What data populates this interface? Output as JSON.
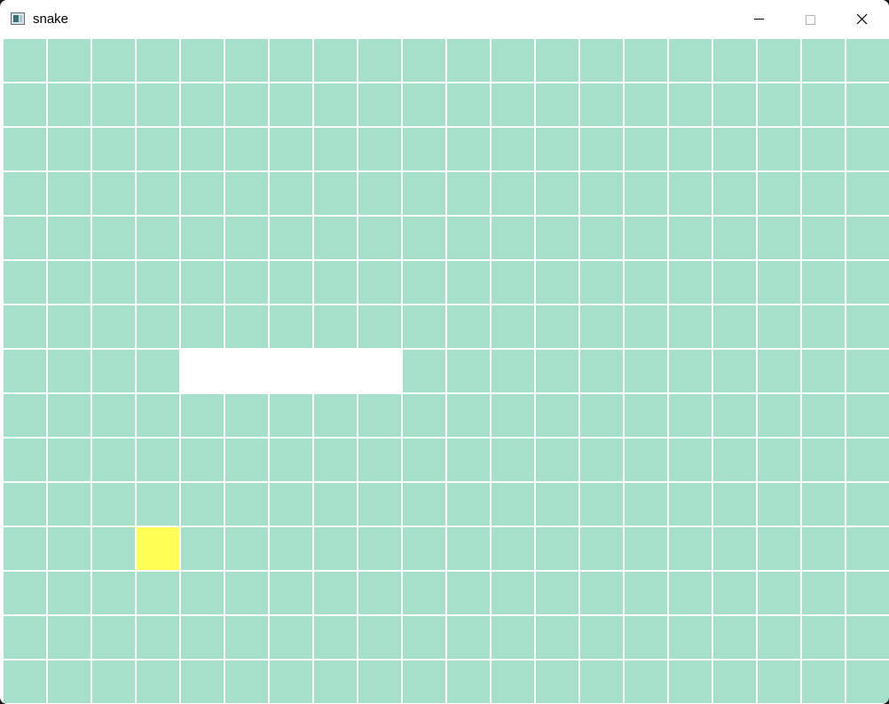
{
  "window": {
    "title": "snake",
    "icon": "app-window-icon",
    "controls": {
      "minimize_icon": "minimize-icon",
      "maximize_icon": "maximize-icon",
      "close_icon": "close-icon"
    }
  },
  "game": {
    "grid": {
      "columns": 20,
      "rows": 15
    },
    "colors": {
      "board": "#a5e0ca",
      "gridline": "#ffffff",
      "snake": "#ffffff",
      "food": "#ffff55"
    },
    "snake": [
      {
        "col": 4,
        "row": 7
      },
      {
        "col": 5,
        "row": 7
      },
      {
        "col": 6,
        "row": 7
      },
      {
        "col": 7,
        "row": 7
      },
      {
        "col": 8,
        "row": 7
      }
    ],
    "food": {
      "col": 3,
      "row": 11
    }
  }
}
